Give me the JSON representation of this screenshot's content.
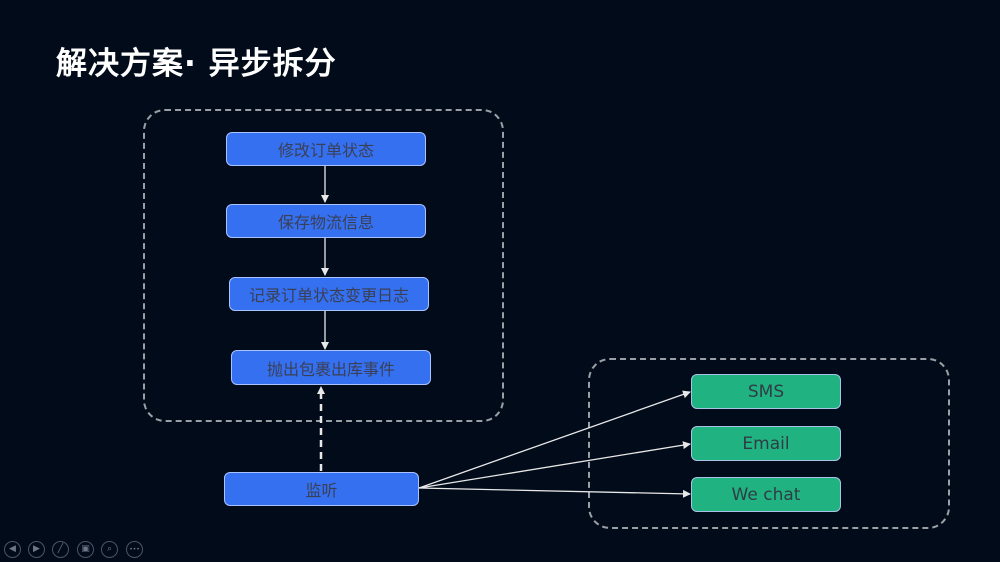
{
  "slide": {
    "title": "解决方案· 异步拆分"
  },
  "colors": {
    "background": "#020b1a",
    "blue_node": "#3470f0",
    "green_node": "#21b282",
    "dashed_border": "#9aa0a6",
    "arrow": "#e8e8e8"
  },
  "flow": {
    "steps": [
      {
        "label": "修改订单状态"
      },
      {
        "label": "保存物流信息"
      },
      {
        "label": "记录订单状态变更日志"
      },
      {
        "label": "抛出包裹出库事件"
      }
    ],
    "listener": {
      "label": "监听"
    },
    "channels": [
      {
        "label": "SMS"
      },
      {
        "label": "Email"
      },
      {
        "label": "We chat"
      }
    ]
  },
  "controls": [
    {
      "icon": "prev-icon",
      "glyph": "◀"
    },
    {
      "icon": "next-icon",
      "glyph": "▶"
    },
    {
      "icon": "pen-icon",
      "glyph": "╱"
    },
    {
      "icon": "slides-icon",
      "glyph": "▣"
    },
    {
      "icon": "zoom-icon",
      "glyph": "⌕"
    },
    {
      "icon": "more-icon",
      "glyph": "•••"
    }
  ]
}
